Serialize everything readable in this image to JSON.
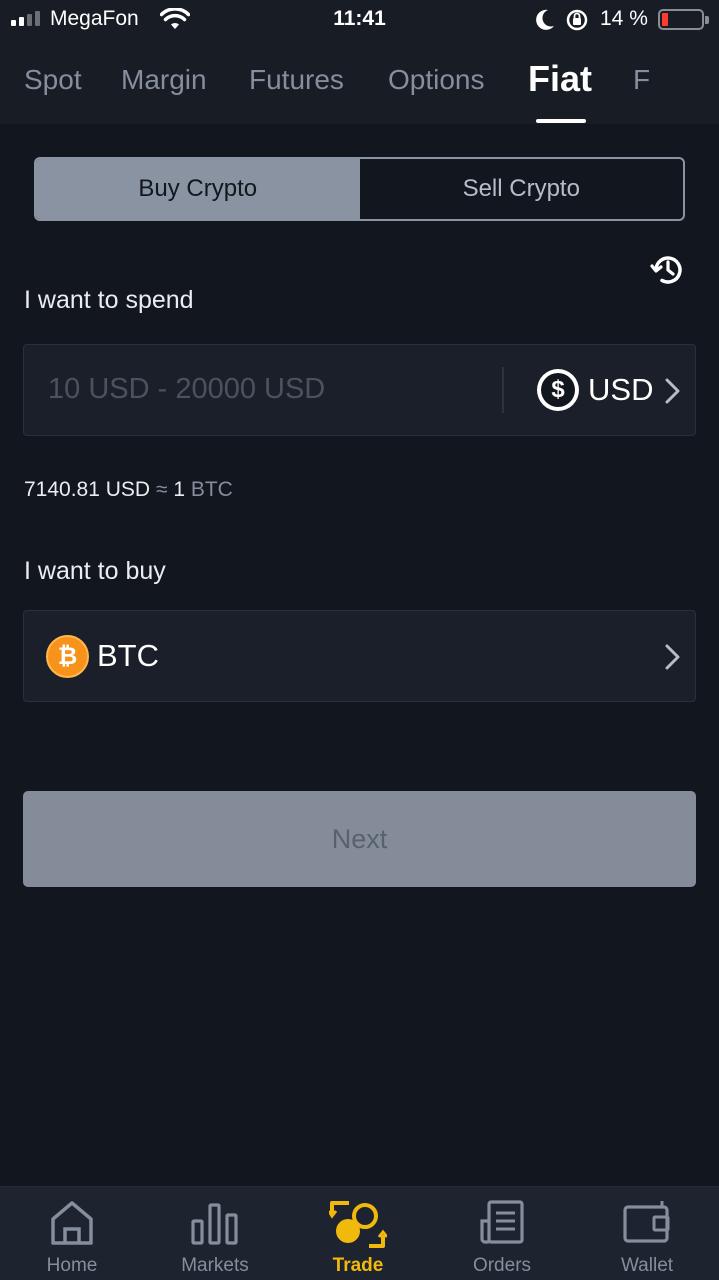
{
  "status_bar": {
    "carrier": "MegaFon",
    "time": "11:41",
    "battery_percent": "14 %",
    "battery_level": 0.14,
    "icons": [
      "signal-icon",
      "wifi-icon",
      "moon-icon",
      "rotation-lock-icon",
      "battery-icon"
    ]
  },
  "tabs": [
    {
      "label": "Spot"
    },
    {
      "label": "Margin"
    },
    {
      "label": "Futures"
    },
    {
      "label": "Options"
    },
    {
      "label": "Fiat",
      "active": true
    },
    {
      "label": "F"
    }
  ],
  "segment": {
    "buy": "Buy Crypto",
    "sell": "Sell Crypto",
    "selected": "Buy Crypto"
  },
  "spend": {
    "label": "I want to spend",
    "placeholder": "10 USD - 20000 USD",
    "currency": "USD",
    "currency_icon": "dollar-icon"
  },
  "rate": {
    "fiat": "7140.81 USD",
    "approx": "≈",
    "amount": "1",
    "crypto": "BTC"
  },
  "buy": {
    "label": "I want to buy",
    "currency": "BTC",
    "currency_icon": "bitcoin-icon",
    "icon_glyph": "₿"
  },
  "next_button": "Next",
  "bottom_nav": [
    {
      "label": "Home",
      "icon": "home-icon"
    },
    {
      "label": "Markets",
      "icon": "bar-chart-icon"
    },
    {
      "label": "Trade",
      "icon": "trade-icon",
      "active": true
    },
    {
      "label": "Orders",
      "icon": "orders-icon"
    },
    {
      "label": "Wallet",
      "icon": "wallet-icon"
    }
  ],
  "colors": {
    "background": "#12161f",
    "accent": "#f0b90b",
    "btc": "#f7931a"
  }
}
